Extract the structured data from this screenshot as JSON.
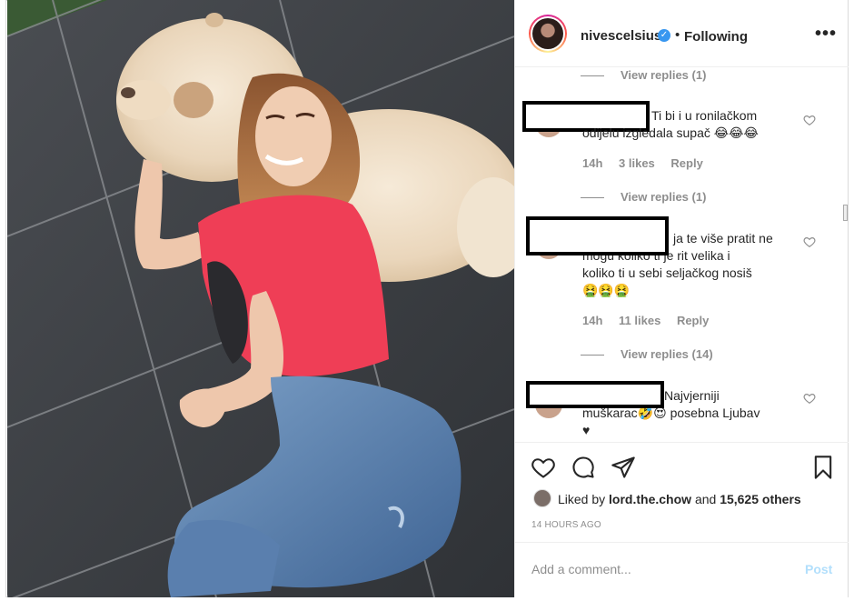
{
  "post": {
    "author": "nivescelsius",
    "follow_status": "Following",
    "separator": "•",
    "more_icon": "more-horizontal-icon"
  },
  "comments": {
    "top_view_replies": "View replies (1)",
    "items": [
      {
        "text_line1": "Ti bi i u ronilačkom",
        "text_line2": "odijelu izgledala supač 😂😂😂",
        "time": "14h",
        "likes": "3 likes",
        "reply": "Reply",
        "view_replies": "View replies (1)"
      },
      {
        "text_line1": "ja te više pratit ne",
        "text_line2": "mogu koliko ti je rit velika i",
        "text_line3": "koliko ti u sebi seljačkog nosiš",
        "text_line4": "🤮🤮🤮",
        "time": "14h",
        "likes": "11 likes",
        "reply": "Reply",
        "view_replies": "View replies (14)"
      },
      {
        "text_line1": "Najvjerniji",
        "text_line2": "muškarac🤣😍 posebna Ljubav",
        "text_line3": "♥"
      }
    ]
  },
  "actions": {
    "like_icon": "heart-icon",
    "comment_icon": "comment-icon",
    "share_icon": "send-icon",
    "save_icon": "bookmark-icon"
  },
  "likes": {
    "prefix": "Liked by",
    "user": "lord.the.chow",
    "joiner": "and",
    "others": "15,625 others"
  },
  "timestamp": "14 HOURS AGO",
  "add_comment": {
    "placeholder": "Add a comment...",
    "post_label": "Post"
  },
  "colors": {
    "text": "#262626",
    "muted": "#8e8e8e",
    "verified": "#3897f0",
    "post_disabled": "#b2dffc"
  }
}
